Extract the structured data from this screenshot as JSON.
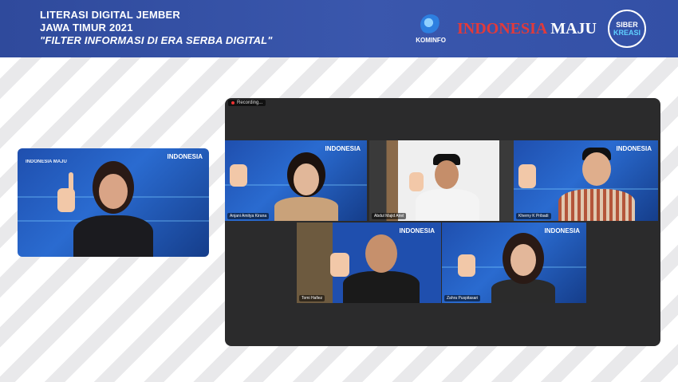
{
  "header": {
    "line1": "LITERASI DIGITAL JEMBER",
    "line2": "JAWA TIMUR 2021",
    "line3": "\"FILTER INFORMASI DI ERA SERBA DIGITAL\"",
    "logos": {
      "kominfo": "KOMINFO",
      "indonesia": "INDONESIA",
      "maju": "MAJU",
      "siber": "SIBER",
      "kreasi": "KREASI"
    }
  },
  "host": {
    "brand": "INDONESIA",
    "mini": "INDONESIA MAJU"
  },
  "meeting": {
    "recording_label": "Recording...",
    "participants": [
      {
        "name": "Anjani Amitya Kirana"
      },
      {
        "name": "Abdul Majid Ariel"
      },
      {
        "name": "Kherny K Pribadi"
      },
      {
        "name": "Tomi Hafiez"
      },
      {
        "name": "Zahra Puspitasari"
      }
    ],
    "tile_brand": "INDONESIA"
  },
  "colors": {
    "header_bg": "#3350a6",
    "tile_bg": "#2a6bd0",
    "meeting_bg": "#2b2b2c"
  }
}
